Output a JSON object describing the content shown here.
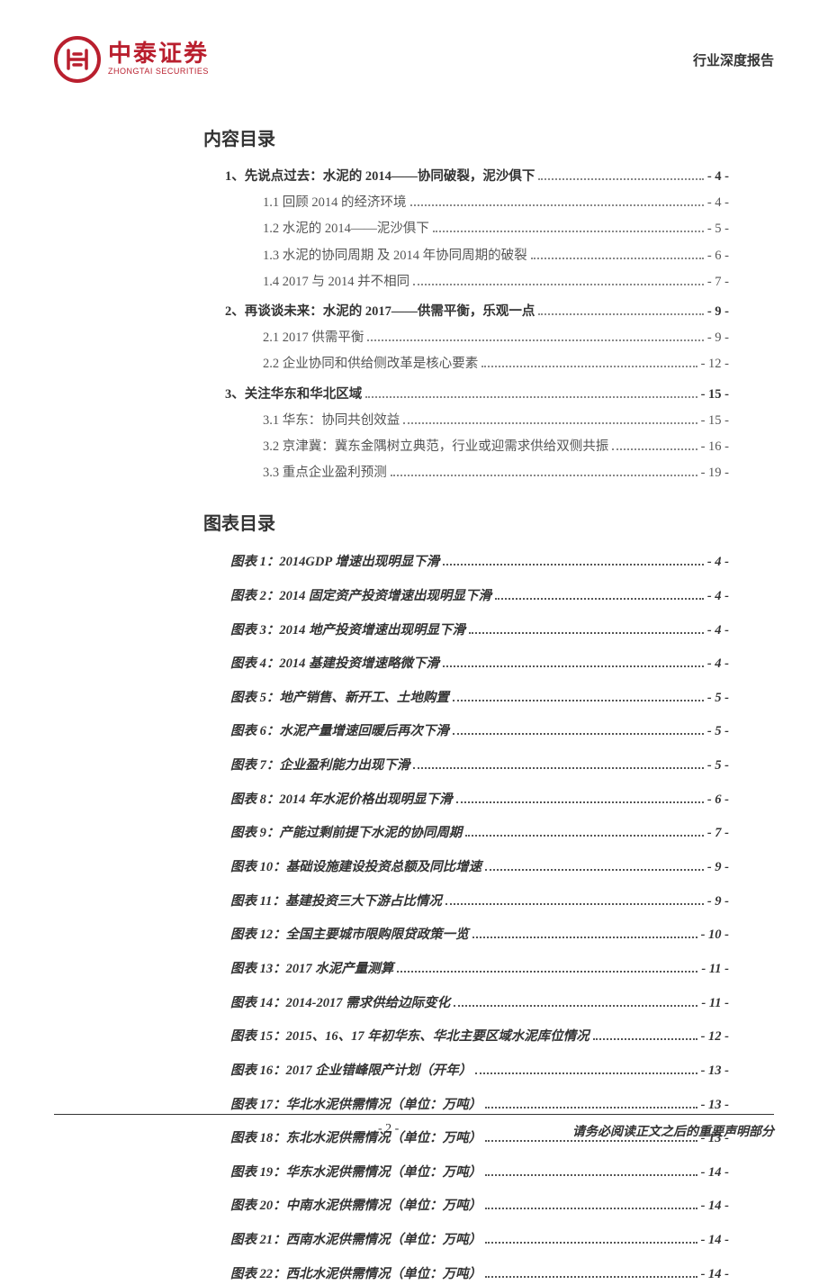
{
  "header": {
    "logo_cn": "中泰证券",
    "logo_en": "ZHONGTAI SECURITIES",
    "report_type": "行业深度报告"
  },
  "toc_title": "内容目录",
  "toc": [
    {
      "level": 1,
      "label": "1、先说点过去：水泥的 2014——协同破裂，泥沙俱下",
      "page": "- 4 -"
    },
    {
      "level": 2,
      "label": "1.1 回顾 2014 的经济环境",
      "page": "- 4 -"
    },
    {
      "level": 2,
      "label": "1.2  水泥的 2014——泥沙俱下",
      "page": "- 5 -"
    },
    {
      "level": 2,
      "label": "1.3 水泥的协同周期 及 2014 年协同周期的破裂",
      "page": "- 6 -"
    },
    {
      "level": 2,
      "label": "1.4 2017 与 2014 并不相同",
      "page": "- 7 -"
    },
    {
      "level": 1,
      "label": "2、再谈谈未来：水泥的 2017——供需平衡，乐观一点",
      "page": "- 9 -"
    },
    {
      "level": 2,
      "label": "2.1 2017 供需平衡",
      "page": "- 9 -"
    },
    {
      "level": 2,
      "label": "2.2 企业协同和供给侧改革是核心要素",
      "page": "- 12 -"
    },
    {
      "level": 1,
      "label": "3、关注华东和华北区域",
      "page": "- 15 -"
    },
    {
      "level": 2,
      "label": "3.1 华东：协同共创效益",
      "page": "- 15 -"
    },
    {
      "level": 2,
      "label": "3.2 京津冀：冀东金隅树立典范，行业或迎需求供给双侧共振",
      "page": "- 16 -"
    },
    {
      "level": 2,
      "label": "3.3 重点企业盈利预测",
      "page": "- 19 -"
    }
  ],
  "figures_title": "图表目录",
  "figures": [
    {
      "label": "图表 1：2014GDP 增速出现明显下滑",
      "page": "- 4 -"
    },
    {
      "label": "图表 2：2014 固定资产投资增速出现明显下滑",
      "page": "- 4 -"
    },
    {
      "label": "图表 3：2014 地产投资增速出现明显下滑",
      "page": "- 4 -"
    },
    {
      "label": "图表 4：2014 基建投资增速略微下滑",
      "page": "- 4 -"
    },
    {
      "label": "图表 5：地产销售、新开工、土地购置",
      "page": "- 5 -"
    },
    {
      "label": "图表 6：水泥产量增速回暖后再次下滑",
      "page": "- 5 -"
    },
    {
      "label": "图表 7：企业盈利能力出现下滑",
      "page": "- 5 -"
    },
    {
      "label": "图表 8：2014 年水泥价格出现明显下滑",
      "page": "- 6 -"
    },
    {
      "label": "图表 9：产能过剩前提下水泥的协同周期",
      "page": "- 7 -"
    },
    {
      "label": "图表 10：基础设施建设投资总额及同比增速",
      "page": "- 9 -"
    },
    {
      "label": "图表 11：基建投资三大下游占比情况",
      "page": "- 9 -"
    },
    {
      "label": "图表 12：全国主要城市限购限贷政策一览",
      "page": "- 10 -"
    },
    {
      "label": "图表 13：2017 水泥产量测算",
      "page": "- 11 -"
    },
    {
      "label": "图表 14：2014-2017 需求供给边际变化",
      "page": "- 11 -"
    },
    {
      "label": "图表 15：2015、16、17 年初华东、华北主要区域水泥库位情况",
      "page": "- 12 -"
    },
    {
      "label": "图表 16：2017 企业错峰限产计划（开年）",
      "page": "- 13 -"
    },
    {
      "label": "图表 17：华北水泥供需情况（单位：万吨）",
      "page": "- 13 -"
    },
    {
      "label": "图表 18：东北水泥供需情况（单位：万吨）",
      "page": "- 13 -"
    },
    {
      "label": "图表 19：华东水泥供需情况（单位：万吨）",
      "page": "- 14 -"
    },
    {
      "label": "图表 20：中南水泥供需情况（单位：万吨）",
      "page": "- 14 -"
    },
    {
      "label": "图表 21：西南水泥供需情况（单位：万吨）",
      "page": "- 14 -"
    },
    {
      "label": "图表 22：西北水泥供需情况（单位：万吨）",
      "page": "- 14 -"
    }
  ],
  "footer": {
    "page_number": "- 2 -",
    "disclaimer": "请务必阅读正文之后的重要声明部分"
  }
}
